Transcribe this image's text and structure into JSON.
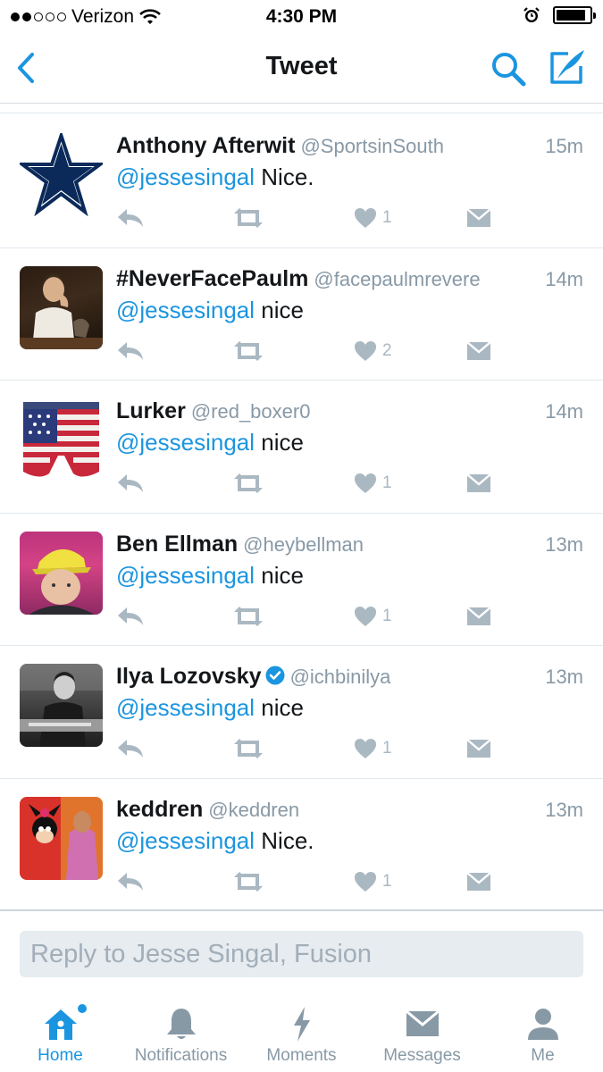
{
  "status_bar": {
    "carrier": "Verizon",
    "time": "4:30 PM",
    "battery_level": 0.9
  },
  "nav": {
    "title": "Tweet",
    "back_icon": "chevron-left-icon",
    "search_icon": "search-icon",
    "compose_icon": "compose-icon"
  },
  "colors": {
    "accent": "#1b95e0",
    "text": "#14171a",
    "muted": "#8899a6",
    "icon_gray": "#aab8c2"
  },
  "tweets": [
    {
      "name": "Anthony Afterwit",
      "handle": "@SportsinSouth",
      "time": "15m",
      "mention": "@jessesingal",
      "text": "Nice.",
      "likes": "1",
      "verified": false,
      "avatar": "dallas-star-avatar"
    },
    {
      "name": "#NeverFacePaulm",
      "handle": "@facepaulmrevere",
      "time": "14m",
      "mention": "@jessesingal",
      "text": "nice",
      "likes": "2",
      "verified": false,
      "avatar": "portrait-avatar"
    },
    {
      "name": "Lurker",
      "handle": "@red_boxer0",
      "time": "14m",
      "mention": "@jessesingal",
      "text": "nice",
      "likes": "1",
      "verified": false,
      "avatar": "flag-boxers-avatar"
    },
    {
      "name": "Ben Ellman",
      "handle": "@heybellman",
      "time": "13m",
      "mention": "@jessesingal",
      "text": "nice",
      "likes": "1",
      "verified": false,
      "avatar": "yellow-cap-avatar"
    },
    {
      "name": "Ilya Lozovsky",
      "handle": "@ichbinilya",
      "time": "13m",
      "mention": "@jessesingal",
      "text": "nice",
      "likes": "1",
      "verified": true,
      "avatar": "bw-photo-avatar"
    },
    {
      "name": "keddren",
      "handle": "@keddren",
      "time": "13m",
      "mention": "@jessesingal",
      "text": "Nice.",
      "likes": "1",
      "verified": false,
      "avatar": "cartoon-avatar"
    }
  ],
  "reply": {
    "placeholder": "Reply to Jesse Singal, Fusion"
  },
  "tabs": [
    {
      "label": "Home",
      "icon": "home-icon",
      "active": true
    },
    {
      "label": "Notifications",
      "icon": "bell-icon",
      "active": false
    },
    {
      "label": "Moments",
      "icon": "lightning-icon",
      "active": false
    },
    {
      "label": "Messages",
      "icon": "envelope-icon",
      "active": false
    },
    {
      "label": "Me",
      "icon": "person-icon",
      "active": false
    }
  ]
}
